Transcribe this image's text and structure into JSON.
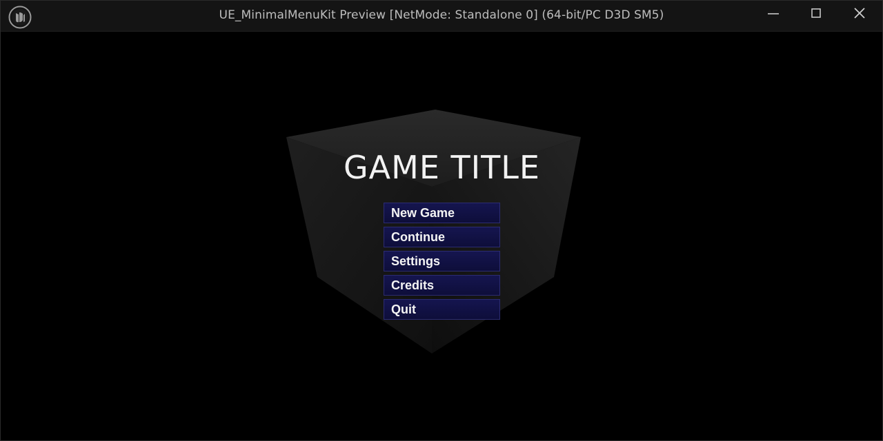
{
  "window": {
    "title": "UE_MinimalMenuKit Preview [NetMode: Standalone 0]  (64-bit/PC D3D SM5)",
    "logo_icon": "unreal-engine-logo-icon",
    "controls": [
      "minimize-icon",
      "maximize-icon",
      "close-icon"
    ]
  },
  "game": {
    "title": "GAME TITLE"
  },
  "menu": {
    "items": [
      {
        "label": "New Game"
      },
      {
        "label": "Continue"
      },
      {
        "label": "Settings"
      },
      {
        "label": "Credits"
      },
      {
        "label": "Quit"
      }
    ]
  },
  "colors": {
    "button_fill": "#13134a",
    "button_border": "#2c2c72",
    "title_text": "#f2f2f2",
    "background": "#000000"
  }
}
